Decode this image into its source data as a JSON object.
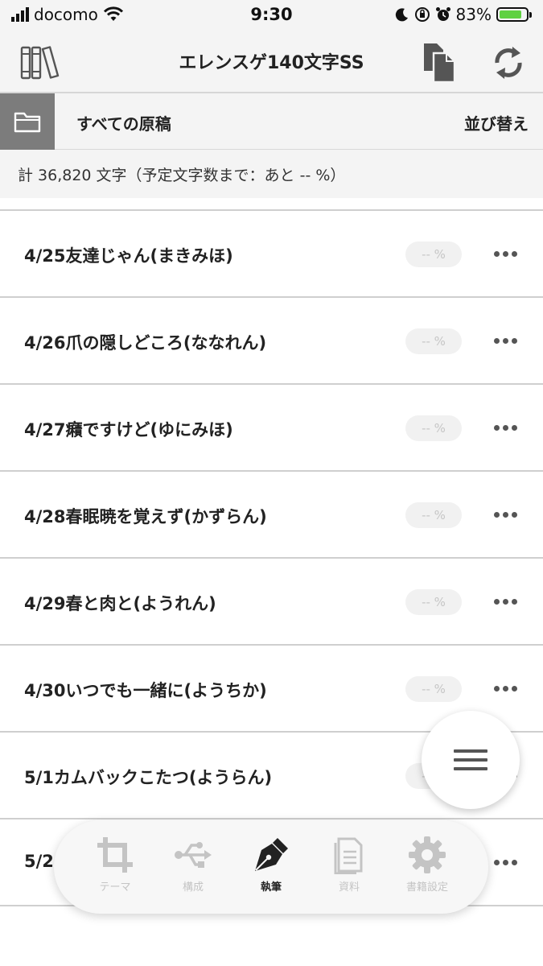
{
  "status": {
    "carrier": "docomo",
    "time": "9:30",
    "battery": "83%",
    "battery_level": 0.83
  },
  "header": {
    "title": "エレンスゲ140文字SS",
    "library_icon": "bookshelf-icon",
    "copy_icon": "copy-documents-icon",
    "sync_icon": "sync-icon"
  },
  "folder": {
    "label": "すべての原稿",
    "sort_label": "並び替え"
  },
  "summary": {
    "text": "計 36,820 文字（予定文字数まで：あと -- %）"
  },
  "items": [
    {
      "title": "4/25友達じゃん(まきみほ)",
      "progress": "-- %"
    },
    {
      "title": "4/26爪の隠しどころ(ななれん)",
      "progress": "-- %"
    },
    {
      "title": "4/27癪ですけど(ゆにみほ)",
      "progress": "-- %"
    },
    {
      "title": "4/28春眠暁を覚えず(かずらん)",
      "progress": "-- %"
    },
    {
      "title": "4/29春と肉と(ようれん)",
      "progress": "-- %"
    },
    {
      "title": "4/30いつでも一緒に(ようちか)",
      "progress": "-- %"
    },
    {
      "title": "5/1カムバックこたつ(ようらん)",
      "progress": "-- %"
    },
    {
      "title": "5/2",
      "progress": "-- %"
    }
  ],
  "nav": {
    "items": [
      {
        "label": "テーマ",
        "icon": "crop-icon"
      },
      {
        "label": "構成",
        "icon": "usb-icon"
      },
      {
        "label": "執筆",
        "icon": "fountain-pen-icon"
      },
      {
        "label": "資料",
        "icon": "document-icon"
      },
      {
        "label": "書籍設定",
        "icon": "gear-icon"
      }
    ],
    "active_index": 2
  },
  "colors": {
    "folder_button": "#7c7c7c",
    "battery_fill": "#5fd141",
    "inactive_nav": "#c4c4c4"
  }
}
